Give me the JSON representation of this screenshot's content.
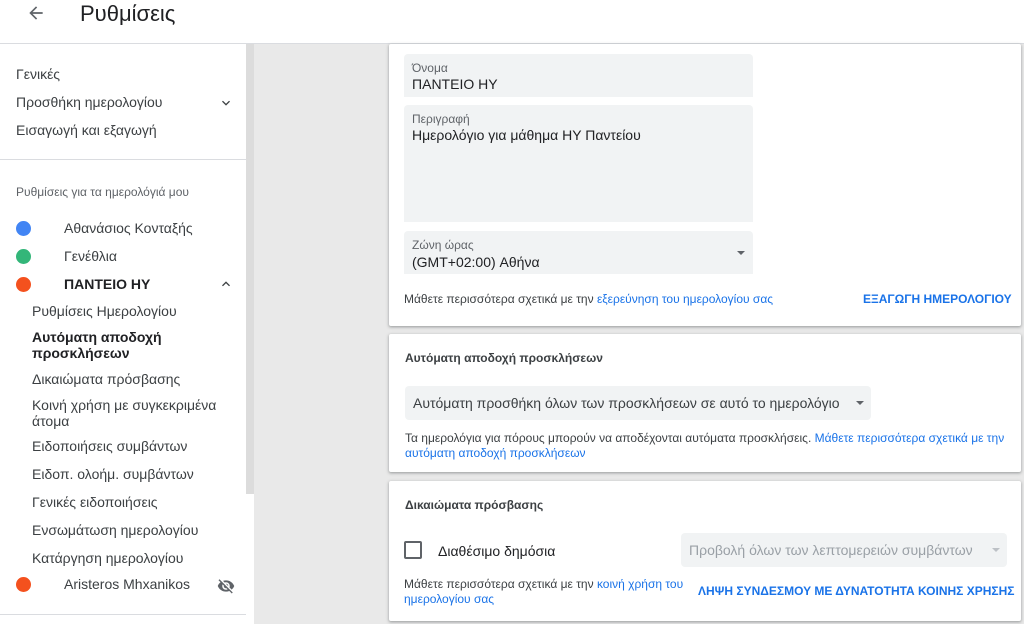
{
  "header": {
    "title": "Ρυθμίσεις",
    "back_icon": "arrow-back-icon"
  },
  "sidebar": {
    "general": "Γενικές",
    "add_calendar": "Προσθήκη ημερολογίου",
    "import_export": "Εισαγωγή και εξαγωγή",
    "my_calendars_heading": "Ρυθμίσεις για τα ημερολόγιά μου",
    "calendars": [
      {
        "name": "Αθανάσιος Κονταξής",
        "color": "#4285f4"
      },
      {
        "name": "Γενέθλια",
        "color": "#33b679"
      },
      {
        "name": "ΠΑΝΤΕΙΟ ΗΥ",
        "color": "#f4511e"
      }
    ],
    "sub_items": [
      "Ρυθμίσεις Ημερολογίου",
      "Αυτόματη αποδοχή προσκλήσεων",
      "Δικαιώματα πρόσβασης",
      "Κοινή χρήση με συγκεκριμένα άτομα",
      "Ειδοποιήσεις συμβάντων",
      "Ειδοπ. ολοήμ. συμβάντων",
      "Γενικές ειδοποιήσεις",
      "Ενσωμάτωση ημερολογίου",
      "Κατάργηση ημερολογίου"
    ],
    "other_calendar": {
      "name": "Aristeros Mhxanikos",
      "color": "#f4511e",
      "icon": "visibility-off-icon"
    }
  },
  "calendar_card": {
    "name_label": "Όνομα",
    "name_value": "ΠΑΝΤΕΙΟ ΗΥ",
    "description_label": "Περιγραφή",
    "description_value": "Ημερολόγιο για μάθημα ΗΥ Παντείου",
    "timezone_label": "Ζώνη ώρας",
    "timezone_value": "(GMT+02:00) Αθήνα",
    "learn_text": "Μάθετε περισσότερα σχετικά με την ",
    "learn_link": "εξερεύνηση του ημερολογίου σας",
    "export_button": "ΕΞΑΓΩΓΗ ΗΜΕΡΟΛΟΓΙΟΥ"
  },
  "auto_accept_card": {
    "title": "Αυτόματη αποδοχή προσκλήσεων",
    "select_value": "Αυτόματη προσθήκη όλων των προσκλήσεων σε αυτό το ημερολόγιο",
    "help_text": "Τα ημερολόγια για πόρους μπορούν να αποδέχονται αυτόματα προσκλήσεις. ",
    "help_link": "Μάθετε περισσότερα σχετικά με την αυτόματη αποδοχή προσκλήσεων"
  },
  "access_card": {
    "title": "Δικαιώματα πρόσβασης",
    "public_label": "Διαθέσιμο δημόσια",
    "public_checked": false,
    "visibility_select": "Προβολή όλων των λεπτομερειών συμβάντων",
    "learn_text": "Μάθετε περισσότερα σχετικά με την ",
    "learn_link": "κοινή χρήση του ημερολογίου σας",
    "share_link_button": "ΛΗΨΗ ΣΥΝΔΕΣΜΟΥ ΜΕ ΔΥΝΑΤΟΤΗΤΑ ΚΟΙΝΗΣ ΧΡΗΣΗΣ"
  }
}
